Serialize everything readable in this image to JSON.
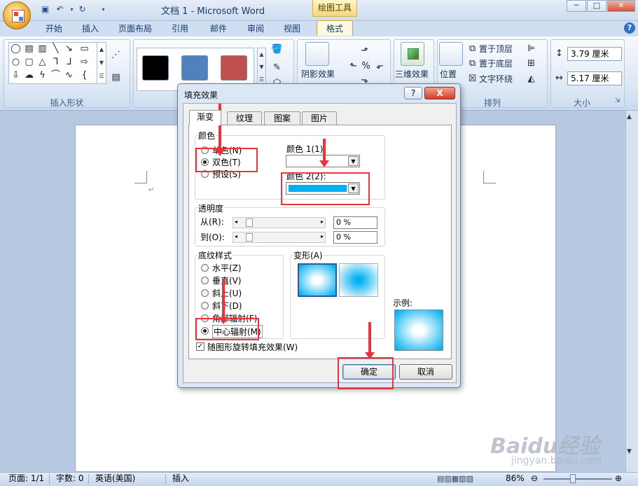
{
  "window": {
    "title": "文档 1 - Microsoft Word",
    "context_tab": "绘图工具"
  },
  "tabs": [
    "开始",
    "插入",
    "页面布局",
    "引用",
    "邮件",
    "审阅",
    "视图",
    "格式"
  ],
  "ribbon": {
    "group_insert_shapes": "插入形状",
    "group_arrange": "排列",
    "group_size": "大小",
    "shadow_label": "阴影效果",
    "threeD_label": "三维效果",
    "position_label": "位置",
    "bring_front": "置于顶层",
    "send_back": "置于底层",
    "text_wrap": "文字环绕",
    "height_value": "3.79 厘米",
    "width_value": "5.17 厘米",
    "style_colors": [
      "#000000",
      "#4f81bd",
      "#c0504d"
    ]
  },
  "dialog": {
    "title": "填充效果",
    "help": "?",
    "close": "X",
    "tabs": [
      "渐变",
      "纹理",
      "图案",
      "图片"
    ],
    "colors_label": "颜色",
    "radio_one": "单色(N)",
    "radio_two": "双色(T)",
    "radio_preset": "预设(S)",
    "color1_label": "颜色 1(1):",
    "color2_label": "颜色 2(2):",
    "color2_value": "#00b0f0",
    "transparency_label": "透明度",
    "from_label": "从(R):",
    "to_label": "到(O):",
    "from_value": "0 %",
    "to_value": "0 %",
    "shading_label": "底纹样式",
    "shading": [
      "水平(Z)",
      "垂直(V)",
      "斜上(U)",
      "斜下(D)",
      "角部辐射(F)",
      "中心辐射(M)"
    ],
    "variants_label": "变形(A)",
    "sample_label": "示例:",
    "rotate_label": "随图形旋转填充效果(W)",
    "ok": "确定",
    "cancel": "取消"
  },
  "status": {
    "page": "页面: 1/1",
    "words": "字数: 0",
    "lang": "英语(美国)",
    "mode": "插入",
    "zoom": "86%"
  },
  "watermark": {
    "brand": "Baidu经验",
    "url": "jingyan.baidu.com"
  }
}
